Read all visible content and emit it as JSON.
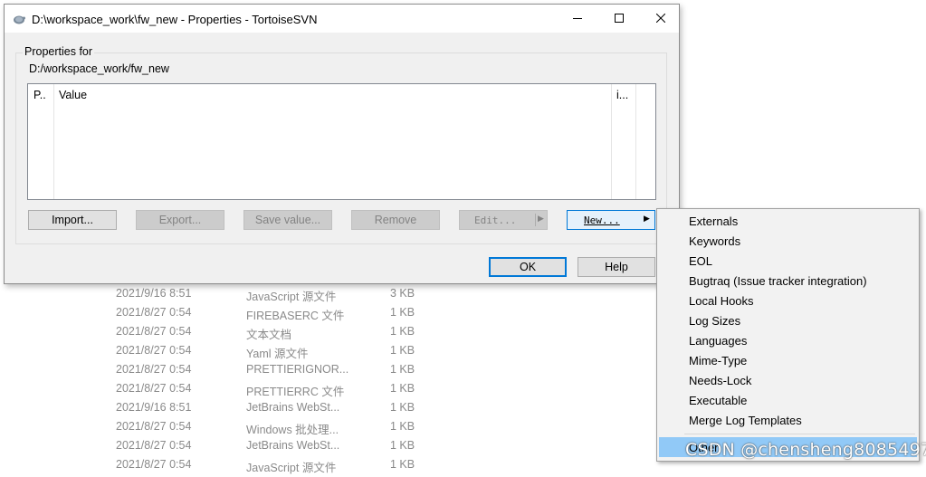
{
  "background_files": [
    {
      "date": "2021/9/16 8:51",
      "type": "JavaScript 源文件",
      "size": "3 KB"
    },
    {
      "date": "2021/8/27 0:54",
      "type": "FIREBASERC 文件",
      "size": "1 KB"
    },
    {
      "date": "2021/8/27 0:54",
      "type": "文本文档",
      "size": "1 KB"
    },
    {
      "date": "2021/8/27 0:54",
      "type": "Yaml 源文件",
      "size": "1 KB"
    },
    {
      "date": "2021/8/27 0:54",
      "type": "PRETTIERIGNOR...",
      "size": "1 KB"
    },
    {
      "date": "2021/8/27 0:54",
      "type": "PRETTIERRC 文件",
      "size": "1 KB"
    },
    {
      "date": "2021/9/16 8:51",
      "type": "JetBrains WebSt...",
      "size": "1 KB"
    },
    {
      "date": "2021/8/27 0:54",
      "type": "Windows 批处理...",
      "size": "1 KB"
    },
    {
      "date": "2021/8/27 0:54",
      "type": "JetBrains WebSt...",
      "size": "1 KB"
    },
    {
      "date": "2021/8/27 0:54",
      "type": "JavaScript 源文件",
      "size": "1 KB"
    }
  ],
  "window": {
    "title": "D:\\workspace_work\\fw_new - Properties - TortoiseSVN",
    "icon": "tortoisesvn-icon",
    "controls": {
      "minimize": "minimize-icon",
      "maximize": "maximize-icon",
      "close": "close-icon"
    }
  },
  "dialog": {
    "group_label": "Properties for",
    "path": "D:/workspace_work/fw_new",
    "columns": [
      "P..",
      "Value",
      "i..."
    ],
    "buttons": {
      "import": "Import...",
      "export": "Export...",
      "save_value": "Save value...",
      "remove": "Remove",
      "edit": "Edit...",
      "new": "New...",
      "ok": "OK",
      "help": "Help"
    }
  },
  "menu": {
    "items": [
      "Externals",
      "Keywords",
      "EOL",
      "Bugtraq (Issue tracker integration)",
      "Local Hooks",
      "Log Sizes",
      "Languages",
      "Mime-Type",
      "Needs-Lock",
      "Executable",
      "Merge Log Templates"
    ],
    "other": "Other",
    "highlighted": "Other"
  },
  "watermark": "CSDN @chensheng8085497"
}
